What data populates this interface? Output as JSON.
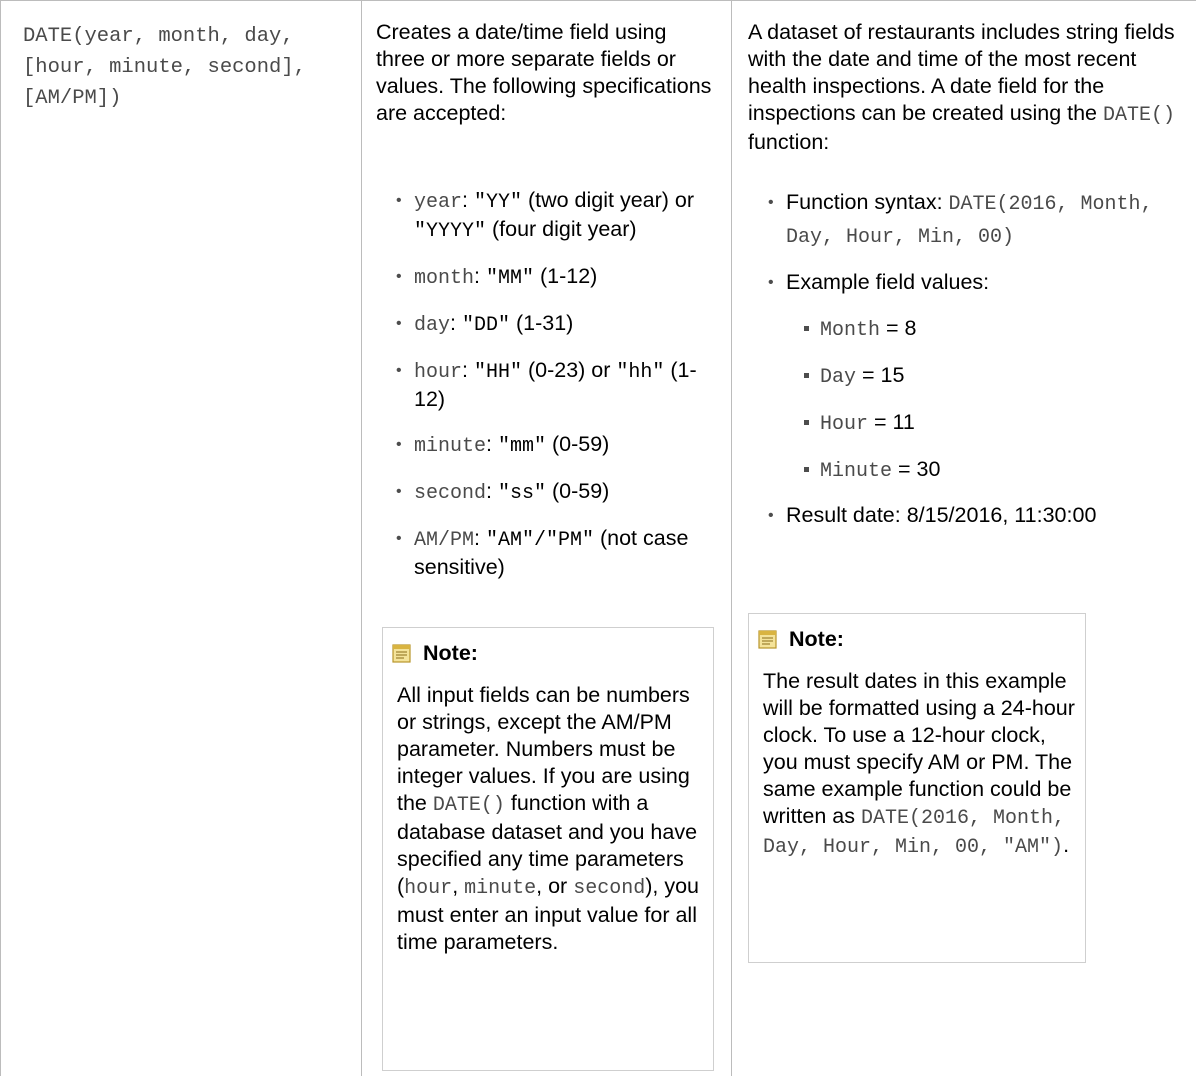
{
  "syntax": "DATE(year, month, day, [hour, minute, second], [AM/PM])",
  "description": {
    "intro": "Creates a date/time field using three or more separate fields or values. The following specifications are accepted:",
    "specs": [
      {
        "key": "year",
        "sep": ": ",
        "v1": "\"YY\"",
        "t1": " (two digit year) or ",
        "v2": "\"YYYY\"",
        "t2": " (four digit year)"
      },
      {
        "key": "month",
        "sep": ": ",
        "v1": "\"MM\"",
        "t1": " (1-12)",
        "v2": "",
        "t2": ""
      },
      {
        "key": "day",
        "sep": ": ",
        "v1": "\"DD\"",
        "t1": " (1-31)",
        "v2": "",
        "t2": ""
      },
      {
        "key": "hour",
        "sep": ": ",
        "v1": "\"HH\"",
        "t1": " (0-23) or ",
        "v2": "\"hh\"",
        "t2": " (1-12)"
      },
      {
        "key": "minute",
        "sep": ": ",
        "v1": "\"mm\"",
        "t1": " (0-59)",
        "v2": "",
        "t2": ""
      },
      {
        "key": "second",
        "sep": ": ",
        "v1": "\"ss\"",
        "t1": " (0-59)",
        "v2": "",
        "t2": ""
      },
      {
        "key": "AM/PM",
        "sep": ": ",
        "v1": "\"AM\"/\"PM\"",
        "t1": " (not case sensitive)",
        "v2": "",
        "t2": ""
      }
    ],
    "note": {
      "title": "Note:",
      "p1": "All input fields can be numbers or strings, except the AM/PM parameter. Numbers must be integer values. If you are using the ",
      "code1": "DATE()",
      "p2": " function with a database dataset and you have specified any time parameters (",
      "code2": "hour",
      "p3": ", ",
      "code3": "minute",
      "p4": ", or ",
      "code4": "second",
      "p5": "), you must enter an input value for all time parameters."
    }
  },
  "example": {
    "intro_a": "A dataset of restaurants includes string fields with the date and time of the most recent health inspections. A date field for the inspections can be created using the ",
    "intro_code": "DATE()",
    "intro_b": " function:",
    "syntax_label": "Function syntax: ",
    "syntax_code": "DATE(2016, Month, Day, Hour, Min, 00)",
    "values_label": "Example field values:",
    "values": [
      {
        "name": "Month",
        "eq": " = ",
        "val": "8"
      },
      {
        "name": "Day",
        "eq": " = ",
        "val": "15"
      },
      {
        "name": "Hour",
        "eq": " = ",
        "val": "11"
      },
      {
        "name": "Minute",
        "eq": " = ",
        "val": "30"
      }
    ],
    "result": "Result date: 8/15/2016, 11:30:00",
    "note": {
      "title": "Note:",
      "p1": "The result dates in this example will be formatted using a 24-hour clock. To use a 12-hour clock, you must specify AM or PM. The same example function could be written as ",
      "code": "DATE(2016, Month, Day, Hour, Min, 00, \"AM\")",
      "p2": "."
    }
  },
  "colors": {
    "border": "#bcbcbc",
    "code": "#4a4a4a",
    "note_border": "#cfcfcf"
  },
  "icons": {
    "note": "note-icon"
  }
}
